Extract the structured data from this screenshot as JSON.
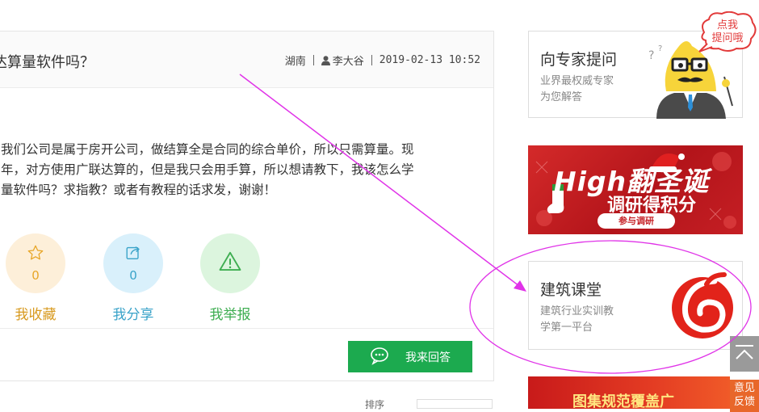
{
  "question": {
    "title": "达算量软件吗？",
    "region": "湖南",
    "author": "李大谷",
    "datetime": "2019-02-13 10:52",
    "body_lines": [
      "我们公司是属于房开公司，做结算全是合同的综合单价，所以只需算量。现",
      "年，对方使用广联达算的，但是我只会用手算，所以想请教下，我该怎么学",
      "量软件吗？求指教？或者有教程的话求发，谢谢！"
    ]
  },
  "actions": {
    "favorite": {
      "count": "0",
      "label": "我收藏",
      "icon": "star-icon"
    },
    "share": {
      "count": "0",
      "label": "我分享",
      "icon": "share-icon"
    },
    "report": {
      "label": "我举报",
      "icon": "warning-icon"
    }
  },
  "answer_button": {
    "label": "我来回答",
    "icon": "chat-bubble-icon"
  },
  "bottom": {
    "sort_label": "排序"
  },
  "sidebar": {
    "expert": {
      "title": "向专家提问",
      "subtitle_lines": [
        "业界最权威专家",
        "为您解答"
      ],
      "bubble_lines": [
        "点我",
        "提问哦"
      ]
    },
    "xmas_banner": {
      "headline": "High翻圣诞",
      "subline": "调研得积分",
      "button": "参与调研"
    },
    "course": {
      "title": "建筑课堂",
      "subtitle_lines": [
        "建筑行业实训教",
        "学第一平台"
      ]
    },
    "bottom_banner": {
      "text": "图集规范覆盖广"
    }
  },
  "floating": {
    "feedback_lines": [
      "意见",
      "反馈"
    ]
  },
  "colors": {
    "favorite": "#e8a628",
    "share": "#3aa3c9",
    "report": "#3fae52",
    "answer_green": "#1caa4f",
    "annotation": "#e033e8"
  }
}
